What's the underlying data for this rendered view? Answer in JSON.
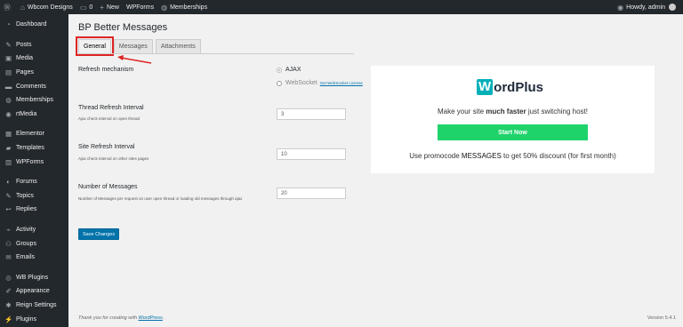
{
  "adminbar": {
    "site_name": "Wbcom Designs",
    "comments_count": "0",
    "new_label": "New",
    "wpforms_label": "WPForms",
    "memberships_label": "Memberships",
    "howdy": "Howdy, admin"
  },
  "sidebar": {
    "items": [
      {
        "label": "Dashboard",
        "icon": "dashboard-icon"
      },
      {
        "label": "Posts",
        "icon": "pin-icon"
      },
      {
        "label": "Media",
        "icon": "media-icon"
      },
      {
        "label": "Pages",
        "icon": "page-icon"
      },
      {
        "label": "Comments",
        "icon": "comment-icon"
      },
      {
        "label": "Memberships",
        "icon": "membership-icon"
      },
      {
        "label": "rtMedia",
        "icon": "rtmedia-icon"
      },
      {
        "label": "Elementor",
        "icon": "elementor-icon"
      },
      {
        "label": "Templates",
        "icon": "folder-icon"
      },
      {
        "label": "WPForms",
        "icon": "form-icon"
      },
      {
        "label": "Forums",
        "icon": "forum-icon"
      },
      {
        "label": "Topics",
        "icon": "topic-icon"
      },
      {
        "label": "Replies",
        "icon": "reply-icon"
      },
      {
        "label": "Activity",
        "icon": "activity-icon"
      },
      {
        "label": "Groups",
        "icon": "groups-icon"
      },
      {
        "label": "Emails",
        "icon": "email-icon"
      },
      {
        "label": "WB Plugins",
        "icon": "plugin-icon"
      },
      {
        "label": "Appearance",
        "icon": "brush-icon"
      },
      {
        "label": "Reign Settings",
        "icon": "gear-icon"
      },
      {
        "label": "Plugins",
        "icon": "plug-icon"
      }
    ]
  },
  "page": {
    "title": "BP Better Messages",
    "tabs": [
      "General",
      "Messages",
      "Attachments"
    ]
  },
  "form": {
    "refresh_mechanism": {
      "label": "Refresh mechanism",
      "option_ajax": "AJAX",
      "option_websocket": "WebSocket",
      "websocket_link": "Get WebSocket License"
    },
    "thread_refresh": {
      "label": "Thread Refresh Interval",
      "desc": "Ajax check interval on open thread",
      "value": "3"
    },
    "site_refresh": {
      "label": "Site Refresh Interval",
      "desc": "Ajax check interval on other sites pages",
      "value": "10"
    },
    "num_messages": {
      "label": "Number of Messages",
      "desc": "Number of Messages per request on user open thread or loading old messages through ajax",
      "value": "20"
    },
    "save_label": "Save Changes"
  },
  "promo": {
    "logo_w": "W",
    "logo_rest": "ordPlus",
    "tagline_pre": "Make your site ",
    "tagline_bold": "much faster",
    "tagline_post": " just switching host!",
    "button": "Start Now",
    "code_pre": "Use promocode ",
    "code": "MESSAGES",
    "code_post": " to get 50% discount (for first month)",
    "button_color": "#1fd36b",
    "logo_color": "#00b0b9"
  },
  "footer": {
    "thanks_pre": "Thank you for creating with ",
    "thanks_link": "WordPress",
    "thanks_post": ".",
    "version": "Version 5.4.1"
  }
}
